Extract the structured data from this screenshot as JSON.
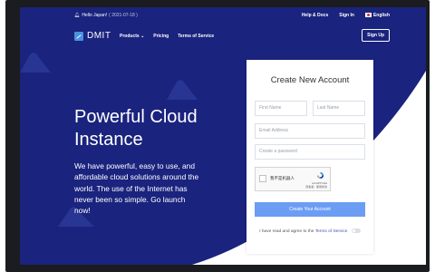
{
  "topbar": {
    "greeting": "Hello Japan!",
    "date": "( 2021-07-18 )",
    "help_docs": "Help & Docs",
    "sign_in": "Sign In",
    "language": "English"
  },
  "nav": {
    "brand": "DMIT",
    "products": "Products",
    "pricing": "Pricing",
    "terms": "Terms of Service",
    "sign_up": "Sign Up"
  },
  "hero": {
    "title": "Powerful Cloud Instance",
    "description": "We have powerful, easy to use, and affordable cloud solutions around the world. The use of the Internet has never been so simple. Go launch now!"
  },
  "form": {
    "title": "Create New Account",
    "first_name_placeholder": "First Name",
    "last_name_placeholder": "Last Name",
    "email_placeholder": "Email Address",
    "password_placeholder": "Create a password",
    "captcha_label": "我不是机器人",
    "captcha_brand": "reCAPTCHA",
    "captcha_links": "隐私权 - 使用条款",
    "submit": "Create Your Account",
    "agree_text": "I have read and agree to the",
    "agree_link": "Terms of Service"
  },
  "colors": {
    "hero_background": "#1a237e",
    "accent_button": "#6b9df4",
    "logo": "#4a90e2"
  }
}
